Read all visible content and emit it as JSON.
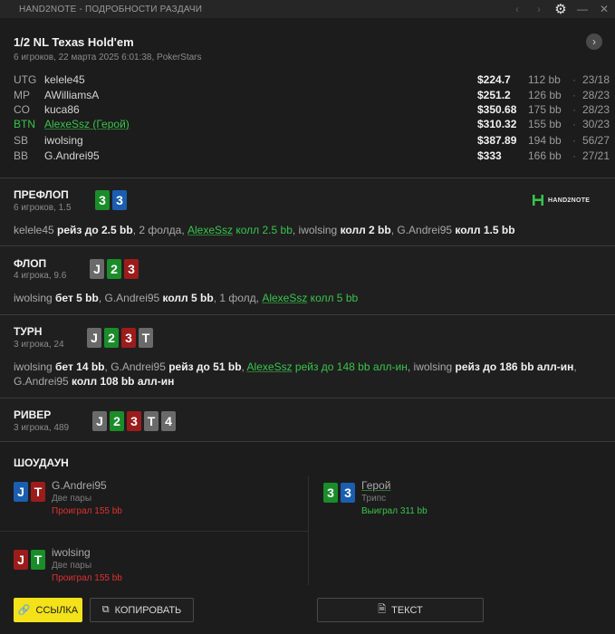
{
  "window": {
    "title": "HAND2NOTE - ПОДРОБНОСТИ РАЗДАЧИ"
  },
  "header": {
    "game_title": "1/2 NL Texas Hold'em",
    "game_sub": "6 игроков, 22 марта 2025 6:01:38, PokerStars"
  },
  "players": [
    {
      "pos": "UTG",
      "name": "kelele45",
      "stack": "$224.7",
      "bb": "112 bb",
      "dot": "·",
      "vp": "23/18"
    },
    {
      "pos": "MP",
      "name": "AWilliamsA",
      "stack": "$251.2",
      "bb": "126 bb",
      "dot": "·",
      "vp": "28/23"
    },
    {
      "pos": "CO",
      "name": "kuca86",
      "stack": "$350.68",
      "bb": "175 bb",
      "dot": "·",
      "vp": "28/23"
    },
    {
      "pos": "BTN",
      "name": "AlexeSsz (Герой)",
      "stack": "$310.32",
      "bb": "155 bb",
      "dot": "·",
      "vp": "30/23"
    },
    {
      "pos": "SB",
      "name": "iwolsing",
      "stack": "$387.89",
      "bb": "194 bb",
      "dot": "·",
      "vp": "56/27"
    },
    {
      "pos": "BB",
      "name": "G.Andrei95",
      "stack": "$333",
      "bb": "166 bb",
      "dot": "·",
      "vp": "27/21"
    }
  ],
  "logo": {
    "text": "HAND2NOTE"
  },
  "preflop": {
    "title": "ПРЕФЛОП",
    "sub": "6 игроков, 1.5",
    "cards": [
      {
        "rank": "3",
        "suit": "green"
      },
      {
        "rank": "3",
        "suit": "blue"
      }
    ],
    "a": [
      "kelele45",
      " рейз до 2.5 bb",
      ", 2 фолда, ",
      "AlexeSsz",
      " колл 2.5 bb",
      ", ",
      "iwolsing",
      " колл 2 bb",
      ", ",
      "G.Andrei95",
      " колл 1.5 bb"
    ]
  },
  "flop": {
    "title": "ФЛОП",
    "sub": "4 игрока, 9.6",
    "cards": [
      {
        "rank": "J",
        "suit": "gray"
      },
      {
        "rank": "2",
        "suit": "green"
      },
      {
        "rank": "3",
        "suit": "red"
      }
    ],
    "a": [
      "iwolsing",
      " бет 5 bb",
      ", ",
      "G.Andrei95",
      " колл 5 bb",
      ", 1 фолд, ",
      "AlexeSsz",
      " колл 5 bb"
    ]
  },
  "turn": {
    "title": "ТУРН",
    "sub": "3 игрока, 24",
    "cards": [
      {
        "rank": "J",
        "suit": "gray"
      },
      {
        "rank": "2",
        "suit": "green"
      },
      {
        "rank": "3",
        "suit": "red"
      },
      {
        "rank": "T",
        "suit": "gray"
      }
    ],
    "a": [
      "iwolsing",
      " бет 14 bb",
      ", ",
      "G.Andrei95",
      " рейз до 51 bb",
      ", ",
      "AlexeSsz",
      " рейз до 148 bb алл-ин",
      ", ",
      "iwolsing",
      " рейз до 186 bb алл-ин",
      ",",
      "G.Andrei95",
      " колл 108 bb алл-ин"
    ]
  },
  "river": {
    "title": "РИВЕР",
    "sub": "3 игрока, 489",
    "cards": [
      {
        "rank": "J",
        "suit": "gray"
      },
      {
        "rank": "2",
        "suit": "green"
      },
      {
        "rank": "3",
        "suit": "red"
      },
      {
        "rank": "T",
        "suit": "gray"
      },
      {
        "rank": "4",
        "suit": "gray"
      }
    ]
  },
  "showdown": {
    "title": "ШОУДАУН",
    "p1": {
      "name": "G.Andrei95",
      "hand": "Две пары",
      "result": "Проиграл 155 bb",
      "cards": [
        {
          "rank": "J",
          "suit": "blue"
        },
        {
          "rank": "T",
          "suit": "red"
        }
      ]
    },
    "p2": {
      "name": "iwolsing",
      "hand": "Две пары",
      "result": "Проиграл 155 bb",
      "cards": [
        {
          "rank": "J",
          "suit": "red"
        },
        {
          "rank": "T",
          "suit": "green"
        }
      ]
    },
    "hero": {
      "name": "Герой",
      "hand": "Трипс",
      "result": "Выиграл 311 bb",
      "cards": [
        {
          "rank": "3",
          "suit": "green"
        },
        {
          "rank": "3",
          "suit": "blue"
        }
      ]
    }
  },
  "buttons": {
    "link": "ССЫЛКА",
    "copy": "КОПИРОВАТЬ",
    "text": "ТЕКСТ"
  },
  "colors": {
    "hero": "#38c54c",
    "lost": "#e03030",
    "accent": "#f3e21a"
  }
}
